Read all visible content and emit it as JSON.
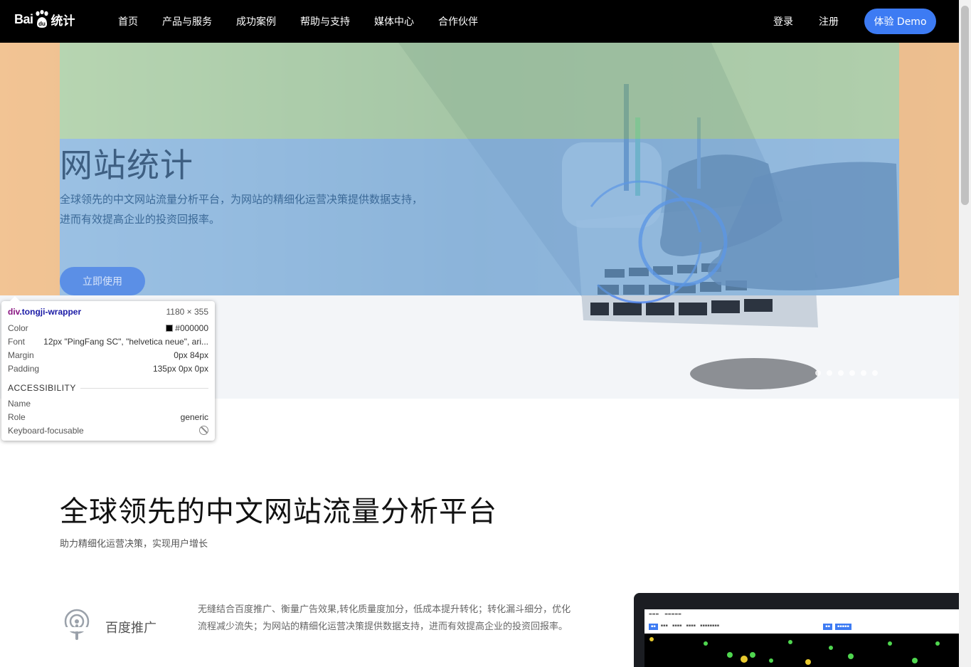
{
  "nav": {
    "logo_text": "Bai",
    "logo_suffix": "统计",
    "links": [
      "首页",
      "产品与服务",
      "成功案例",
      "帮助与支持",
      "媒体中心",
      "合作伙伴"
    ],
    "login": "登录",
    "register": "注册",
    "demo": "体验 Demo"
  },
  "hero": {
    "title": "网站统计",
    "description": "全球领先的中文网站流量分析平台，为网站的精细化运营决策提供数据支持，进而有效提高企业的投资回报率。",
    "cta": "立即使用",
    "slide_count": 6
  },
  "inspector": {
    "selector_tag": "div",
    "selector_class": ".tongji-wrapper",
    "dimensions": "1180 × 355",
    "rows": [
      {
        "label": "Color",
        "value": "#000000"
      },
      {
        "label": "Font",
        "value": "12px \"PingFang SC\", \"helvetica neue\", ari..."
      },
      {
        "label": "Margin",
        "value": "0px 84px"
      },
      {
        "label": "Padding",
        "value": "135px 0px 0px"
      }
    ],
    "accessibility_heading": "ACCESSIBILITY",
    "accessibility": [
      {
        "label": "Name",
        "value": ""
      },
      {
        "label": "Role",
        "value": "generic"
      },
      {
        "label": "Keyboard-focusable",
        "value": ""
      }
    ]
  },
  "section": {
    "title": "全球领先的中文网站流量分析平台",
    "subtitle": "助力精细化运营决策，实现用户增长",
    "feature": {
      "icon": "signal-broadcast-icon",
      "name": "百度推广",
      "description": "无缝结合百度推广、衡量广告效果,转化质量度加分，低成本提升转化；转化漏斗细分，优化流程减少流失；为网站的精细化运营决策提供数据支持，进而有效提高企业的投资回报率。"
    }
  },
  "colors": {
    "nav_bg": "#000000",
    "accent": "#3d7bf3",
    "margin_overlay": "#f6b26b",
    "padding_overlay": "#93c47d",
    "content_overlay": "#6fa8dc"
  }
}
